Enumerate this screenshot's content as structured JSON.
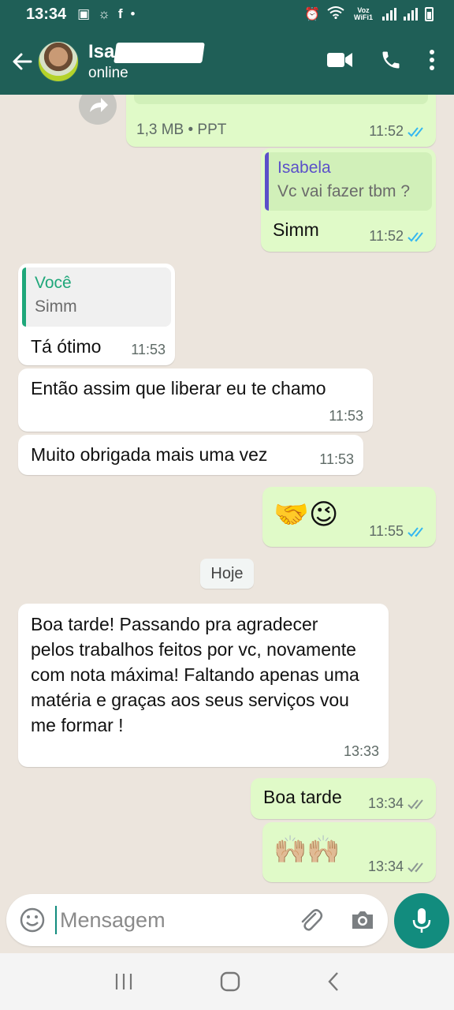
{
  "status_bar": {
    "time": "13:34",
    "voz_label": "Voz WiFi1"
  },
  "header": {
    "contact_name": "Isa",
    "status": "online"
  },
  "messages": {
    "m0": {
      "file_meta": "1,3 MB • PPT",
      "time": "11:52"
    },
    "m1": {
      "quote_name": "Isabela",
      "quote_text": "Vc vai fazer tbm ?",
      "text": "Simm",
      "time": "11:52"
    },
    "m2": {
      "quote_name": "Você",
      "quote_text": "Simm",
      "text": "Tá ótimo",
      "time": "11:53"
    },
    "m3": {
      "text": "Então assim que liberar eu te chamo",
      "time": "11:53"
    },
    "m4": {
      "text": "Muito obrigada mais uma vez",
      "time": "11:53"
    },
    "m5": {
      "text": "🤝😉",
      "time": "11:55"
    },
    "m6": {
      "text": "Boa tarde! Passando pra agradecer pelos trabalhos feitos por vc, novamente com nota máxima! Faltando apenas uma matéria e graças aos seus serviços vou me formar !",
      "time": "13:33"
    },
    "m7": {
      "text": "Boa tarde",
      "time": "13:34"
    },
    "m8": {
      "text": "🙌🏼🙌🏼",
      "time": "13:34"
    }
  },
  "date_chip": "Hoje",
  "composer": {
    "placeholder": "Mensagem"
  },
  "colors": {
    "header_bg": "#1f5f57",
    "chat_bg": "#ece5dd",
    "outgoing_bubble": "#e0fac8",
    "incoming_bubble": "#ffffff",
    "read_tick": "#34b7f1",
    "accent": "#128c7e"
  },
  "icons": [
    "back-arrow-icon",
    "video-call-icon",
    "phone-icon",
    "more-vert-icon",
    "emoji-icon",
    "attach-icon",
    "camera-icon",
    "mic-icon",
    "forward-icon",
    "recents-nav-icon",
    "home-nav-icon",
    "back-nav-icon"
  ]
}
